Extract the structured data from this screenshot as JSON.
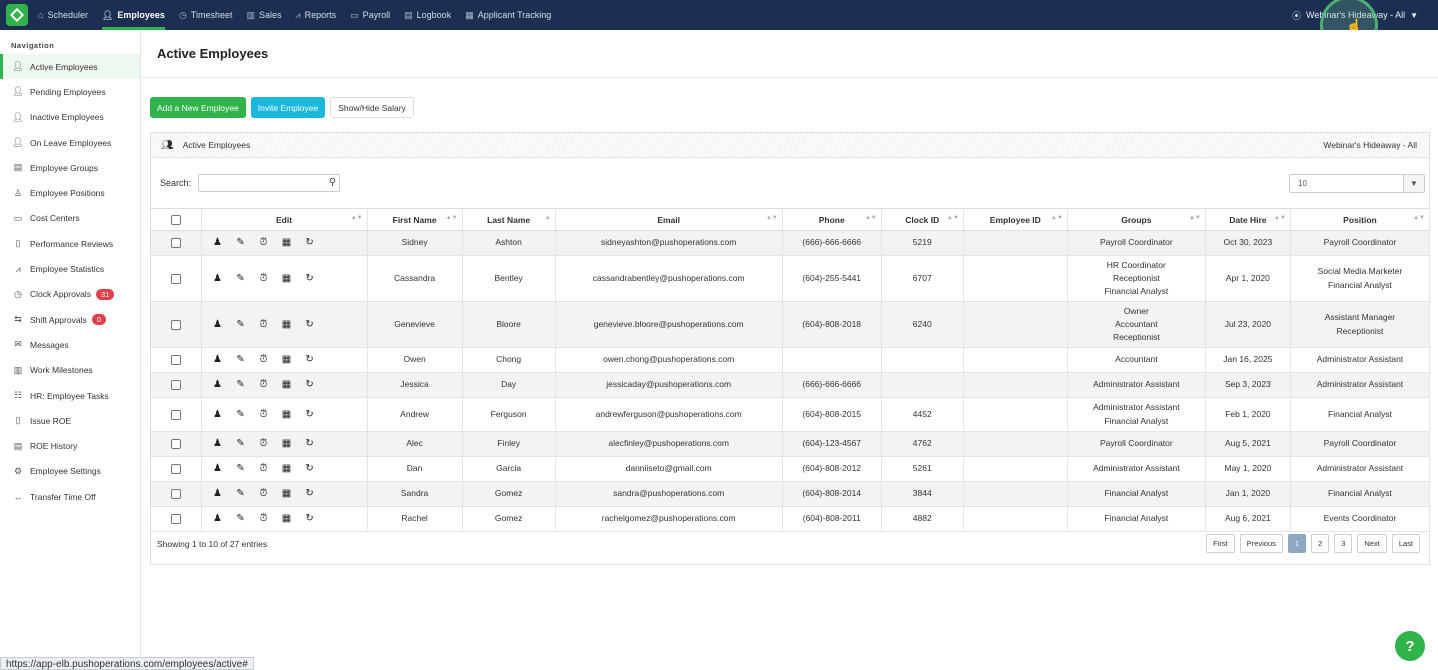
{
  "topnav": {
    "items": [
      {
        "label": "Scheduler",
        "icon": "home-icon"
      },
      {
        "label": "Employees",
        "icon": "person-icon"
      },
      {
        "label": "Timesheet",
        "icon": "clock-icon"
      },
      {
        "label": "Sales",
        "icon": "chart-icon"
      },
      {
        "label": "Reports",
        "icon": "line-chart-icon"
      },
      {
        "label": "Payroll",
        "icon": "money-icon"
      },
      {
        "label": "Logbook",
        "icon": "book-icon"
      },
      {
        "label": "Applicant Tracking",
        "icon": "clipboard-icon"
      }
    ],
    "location": "Webinar's Hideaway - All"
  },
  "sidebar": {
    "title": "Navigation",
    "items": [
      {
        "label": "Active Employees"
      },
      {
        "label": "Pending Employees"
      },
      {
        "label": "Inactive Employees"
      },
      {
        "label": "On Leave Employees"
      },
      {
        "label": "Employee Groups"
      },
      {
        "label": "Employee Positions"
      },
      {
        "label": "Cost Centers"
      },
      {
        "label": "Performance Reviews"
      },
      {
        "label": "Employee Statistics"
      },
      {
        "label": "Clock Approvals",
        "badge": "31"
      },
      {
        "label": "Shift Approvals",
        "badge": "0"
      },
      {
        "label": "Messages"
      },
      {
        "label": "Work Milestones"
      },
      {
        "label": "HR: Employee Tasks"
      },
      {
        "label": "Issue ROE"
      },
      {
        "label": "ROE History"
      },
      {
        "label": "Employee Settings"
      },
      {
        "label": "Transfer Time Off"
      }
    ]
  },
  "main": {
    "title": "Active Employees",
    "buttons": {
      "add": "Add a New Employee",
      "invite": "Invite Employee",
      "toggle_salary": "Show/Hide Salary"
    },
    "panel_title": "Active Employees",
    "panel_location": "Webinar's Hideaway - All",
    "search_label": "Search:",
    "search_value": "",
    "page_size": "10",
    "columns": [
      "Edit",
      "First Name",
      "Last Name",
      "Email",
      "Phone",
      "Clock ID",
      "Employee ID",
      "Groups",
      "Date Hire",
      "Position"
    ],
    "rows": [
      {
        "first": "Sidney",
        "last": "Ashton",
        "email": "sidneyashton@pushoperations.com",
        "phone": "(666)-666-6666",
        "clock": "5219",
        "emp_id": "",
        "groups": [
          "Payroll Coordinator"
        ],
        "hire": "Oct 30, 2023",
        "positions": [
          "Payroll Coordinator"
        ]
      },
      {
        "first": "Cassandra",
        "last": "Bentley",
        "email": "cassandrabentley@pushoperations.com",
        "phone": "(604)-255-5441",
        "clock": "6707",
        "emp_id": "",
        "groups": [
          "HR Coordinator",
          "Receptionist",
          "Financial Analyst"
        ],
        "hire": "Apr 1, 2020",
        "positions": [
          "Social Media Marketer",
          "Financial Analyst"
        ]
      },
      {
        "first": "Genevieve",
        "last": "Bloore",
        "email": "genevieve.bloore@pushoperations.com",
        "phone": "(604)-808-2018",
        "clock": "6240",
        "emp_id": "",
        "groups": [
          "Owner",
          "Accountant",
          "Receptionist"
        ],
        "hire": "Jul 23, 2020",
        "positions": [
          "Assistant Manager",
          "Receptionist"
        ]
      },
      {
        "first": "Owen",
        "last": "Chong",
        "email": "owen.chong@pushoperations.com",
        "phone": "",
        "clock": "",
        "emp_id": "",
        "groups": [
          "Accountant"
        ],
        "hire": "Jan 16, 2025",
        "positions": [
          "Administrator Assistant"
        ]
      },
      {
        "first": "Jessica",
        "last": "Day",
        "email": "jessicaday@pushoperations.com",
        "phone": "(666)-666-6666",
        "clock": "",
        "emp_id": "",
        "groups": [
          "Administrator Assistant"
        ],
        "hire": "Sep 3, 2023",
        "positions": [
          "Administrator Assistant"
        ]
      },
      {
        "first": "Andrew",
        "last": "Ferguson",
        "email": "andrewferguson@pushoperations.com",
        "phone": "(604)-808-2015",
        "clock": "4452",
        "emp_id": "",
        "groups": [
          "Administrator Assistant",
          "Financial Analyst"
        ],
        "hire": "Feb 1, 2020",
        "positions": [
          "Financial Analyst"
        ]
      },
      {
        "first": "Alec",
        "last": "Finley",
        "email": "alecfinley@pushoperations.com",
        "phone": "(604)-123-4567",
        "clock": "4762",
        "emp_id": "",
        "groups": [
          "Payroll Coordinator"
        ],
        "hire": "Aug 5, 2021",
        "positions": [
          "Payroll Coordinator"
        ]
      },
      {
        "first": "Dan",
        "last": "Garcia",
        "email": "danniiseto@gmail.com",
        "phone": "(604)-808-2012",
        "clock": "5261",
        "emp_id": "",
        "groups": [
          "Administrator Assistant"
        ],
        "hire": "May 1, 2020",
        "positions": [
          "Administrator Assistant"
        ]
      },
      {
        "first": "Sandra",
        "last": "Gomez",
        "email": "sandra@pushoperations.com",
        "phone": "(604)-808-2014",
        "clock": "3844",
        "emp_id": "",
        "groups": [
          "Financial Analyst"
        ],
        "hire": "Jan 1, 2020",
        "positions": [
          "Financial Analyst"
        ]
      },
      {
        "first": "Rachel",
        "last": "Gomez",
        "email": "rachelgomez@pushoperations.com",
        "phone": "(604)-808-2011",
        "clock": "4882",
        "emp_id": "",
        "groups": [
          "Financial Analyst"
        ],
        "hire": "Aug 6, 2021",
        "positions": [
          "Events Coordinator"
        ]
      }
    ],
    "row_actions": [
      "employee-profile-icon",
      "pencil-icon",
      "alarm-clock-icon",
      "calendar-icon",
      "refresh-icon"
    ],
    "info": "Showing 1 to 10 of 27 entries",
    "pagination": {
      "first": "First",
      "previous": "Previous",
      "pages": [
        "1",
        "2",
        "3"
      ],
      "current": "1",
      "next": "Next",
      "last": "Last"
    }
  },
  "status_url": "https://app-elb.pushoperations.com/employees/active#",
  "colors": {
    "topbar": "#1c2e52",
    "accent_green": "#2fb34a",
    "invite_cyan": "#19b8dc",
    "badge_red": "#e0404a"
  }
}
